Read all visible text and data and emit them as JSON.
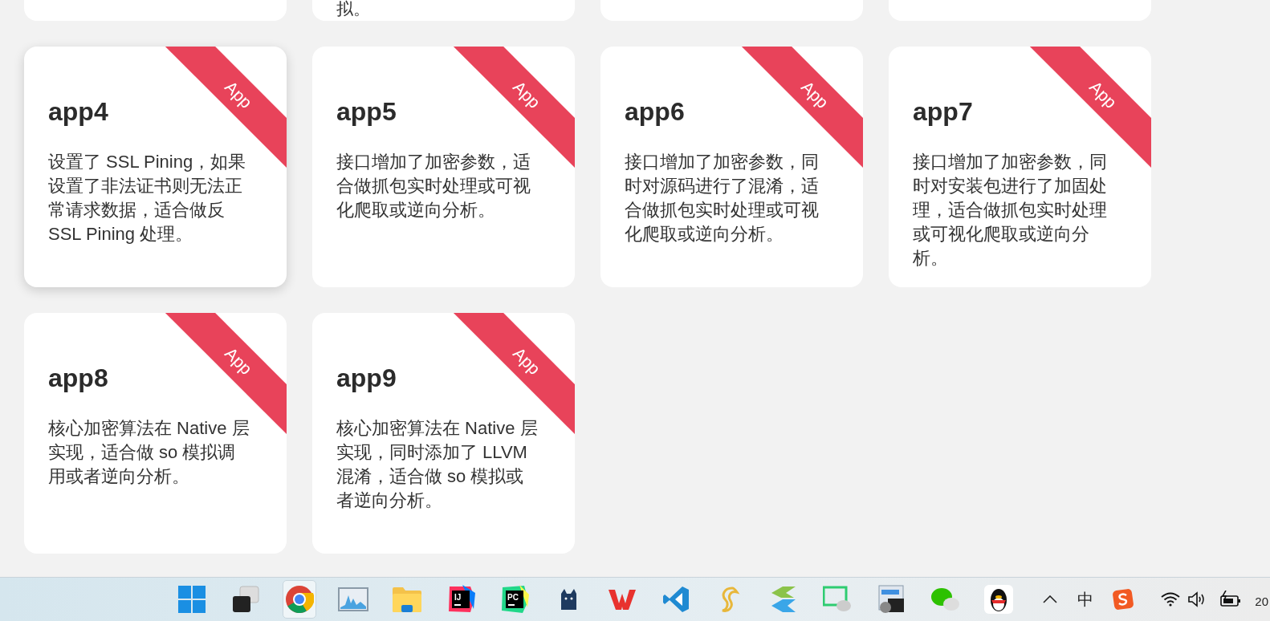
{
  "clipped_text": "拟。",
  "cards": [
    {
      "title": "app4",
      "ribbon": "App",
      "description": "设置了 SSL Pining，如果设置了非法证书则无法正常请求数据，适合做反 SSL Pining 处理。",
      "hovered": true
    },
    {
      "title": "app5",
      "ribbon": "App",
      "description": "接口增加了加密参数，适合做抓包实时处理或可视化爬取或逆向分析。",
      "hovered": false
    },
    {
      "title": "app6",
      "ribbon": "App",
      "description": "接口增加了加密参数，同时对源码进行了混淆，适合做抓包实时处理或可视化爬取或逆向分析。",
      "hovered": false
    },
    {
      "title": "app7",
      "ribbon": "App",
      "description": "接口增加了加密参数，同时对安装包进行了加固处理，适合做抓包实时处理或可视化爬取或逆向分析。",
      "hovered": false
    },
    {
      "title": "app8",
      "ribbon": "App",
      "description": "核心加密算法在 Native 层实现，适合做 so 模拟调用或者逆向分析。",
      "hovered": false
    },
    {
      "title": "app9",
      "ribbon": "App",
      "description": "核心加密算法在 Native 层实现，同时添加了 LLVM 混淆，适合做 so 模拟或者逆向分析。",
      "hovered": false
    }
  ],
  "taskbar": {
    "apps": [
      {
        "kind": "start",
        "selected": false
      },
      {
        "kind": "taskview",
        "selected": false
      },
      {
        "kind": "browser",
        "selected": true
      },
      {
        "kind": "monitor",
        "selected": false
      },
      {
        "kind": "folder",
        "selected": false
      },
      {
        "kind": "ij",
        "label": "IJ",
        "selected": false
      },
      {
        "kind": "pc",
        "label": "PC",
        "selected": false
      },
      {
        "kind": "cat",
        "selected": false
      },
      {
        "kind": "wps",
        "selected": false
      },
      {
        "kind": "code",
        "selected": false
      },
      {
        "kind": "swirl",
        "selected": false
      },
      {
        "kind": "layers",
        "selected": false
      },
      {
        "kind": "screenchat",
        "selected": false
      },
      {
        "kind": "remote",
        "selected": false
      },
      {
        "kind": "chat",
        "selected": false
      },
      {
        "kind": "penguin",
        "selected": false
      }
    ],
    "ime": "中",
    "clock": "20"
  }
}
